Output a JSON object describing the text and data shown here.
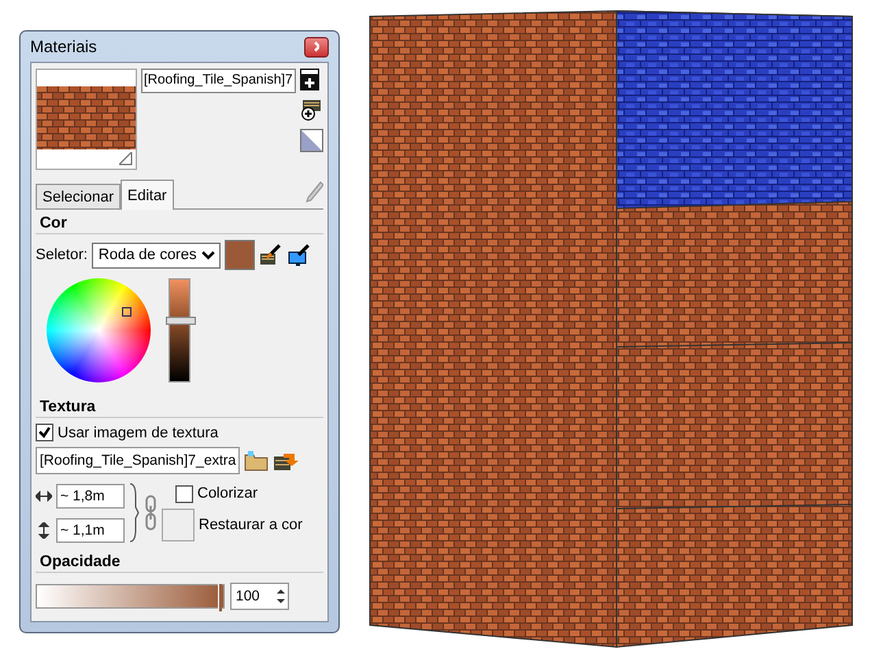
{
  "window": {
    "title": "Materiais"
  },
  "material": {
    "name": "[Roofing_Tile_Spanish]7"
  },
  "tabs": [
    {
      "label": "Selecionar",
      "selected": false
    },
    {
      "label": "Editar",
      "selected": true
    }
  ],
  "color": {
    "heading": "Cor",
    "selector_label": "Seletor:",
    "selector_value": "Roda de cores",
    "level": 0.58
  },
  "texture": {
    "heading": "Textura",
    "use_texture": {
      "label": "Usar imagem de textura",
      "checked": true
    },
    "file": "[Roofing_Tile_Spanish]7_extra",
    "width": "~ 1,8m",
    "height": "~ 1,1m",
    "colorize": {
      "label": "Colorizar",
      "checked": false
    },
    "reset_label": "Restaurar a cor"
  },
  "opacity": {
    "heading": "Opacidade",
    "level": 1,
    "value": "100"
  }
}
